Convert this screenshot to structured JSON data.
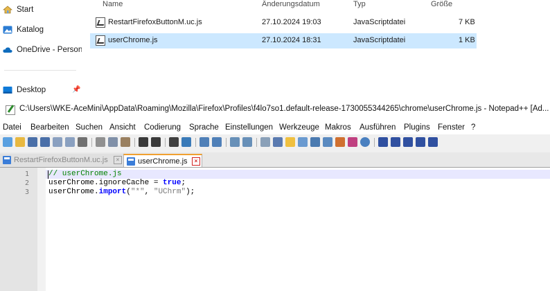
{
  "explorer": {
    "nav": [
      {
        "label": "Start",
        "icon": "home-icon"
      },
      {
        "label": "Katalog",
        "icon": "gallery-icon"
      },
      {
        "label": "OneDrive - Persona",
        "icon": "cloud-icon"
      },
      {
        "label": "Desktop",
        "icon": "desktop-icon"
      }
    ],
    "columns": {
      "name": "Name",
      "date": "Änderungsdatum",
      "type": "Typ",
      "size": "Größe"
    },
    "files": [
      {
        "name": "RestartFirefoxButtonM.uc.js",
        "date": "27.10.2024 19:03",
        "type": "JavaScriptdatei",
        "size": "7 KB",
        "selected": false
      },
      {
        "name": "userChrome.js",
        "date": "27.10.2024 18:31",
        "type": "JavaScriptdatei",
        "size": "1 KB",
        "selected": true
      }
    ]
  },
  "notepad": {
    "title": "C:\\Users\\WKE-AceMini\\AppData\\Roaming\\Mozilla\\Firefox\\Profiles\\f4lo7so1.default-release-1730055344265\\chrome\\userChrome.js - Notepad++ [Ad...",
    "menu": [
      "Datei",
      "Bearbeiten",
      "Suchen",
      "Ansicht",
      "Codierung",
      "Sprache",
      "Einstellungen",
      "Werkzeuge",
      "Makros",
      "Ausführen",
      "Plugins",
      "Fenster",
      "?"
    ],
    "tabs": [
      {
        "label": "RestartFirefoxButtonM.uc.js",
        "close": "×",
        "active": false
      },
      {
        "label": "userChrome.js",
        "close": "×",
        "active": true
      }
    ],
    "line_numbers": [
      "1",
      "2",
      "3"
    ],
    "code": {
      "line1": "// userChrome.js",
      "line2_a": "userChrome.ignoreCache = ",
      "line2_kw": "true",
      "line2_b": ";",
      "line3_a": "userChrome.",
      "line3_kw": "import",
      "line3_b": "(",
      "line3_s1": "\"*\"",
      "line3_c": ", ",
      "line3_s2": "\"UChrm\"",
      "line3_d": ");"
    }
  },
  "colors": {
    "selection": "#cce8ff",
    "active_tab_accent": "#f0a030",
    "comment": "#008000",
    "keyword": "#0000ff"
  }
}
